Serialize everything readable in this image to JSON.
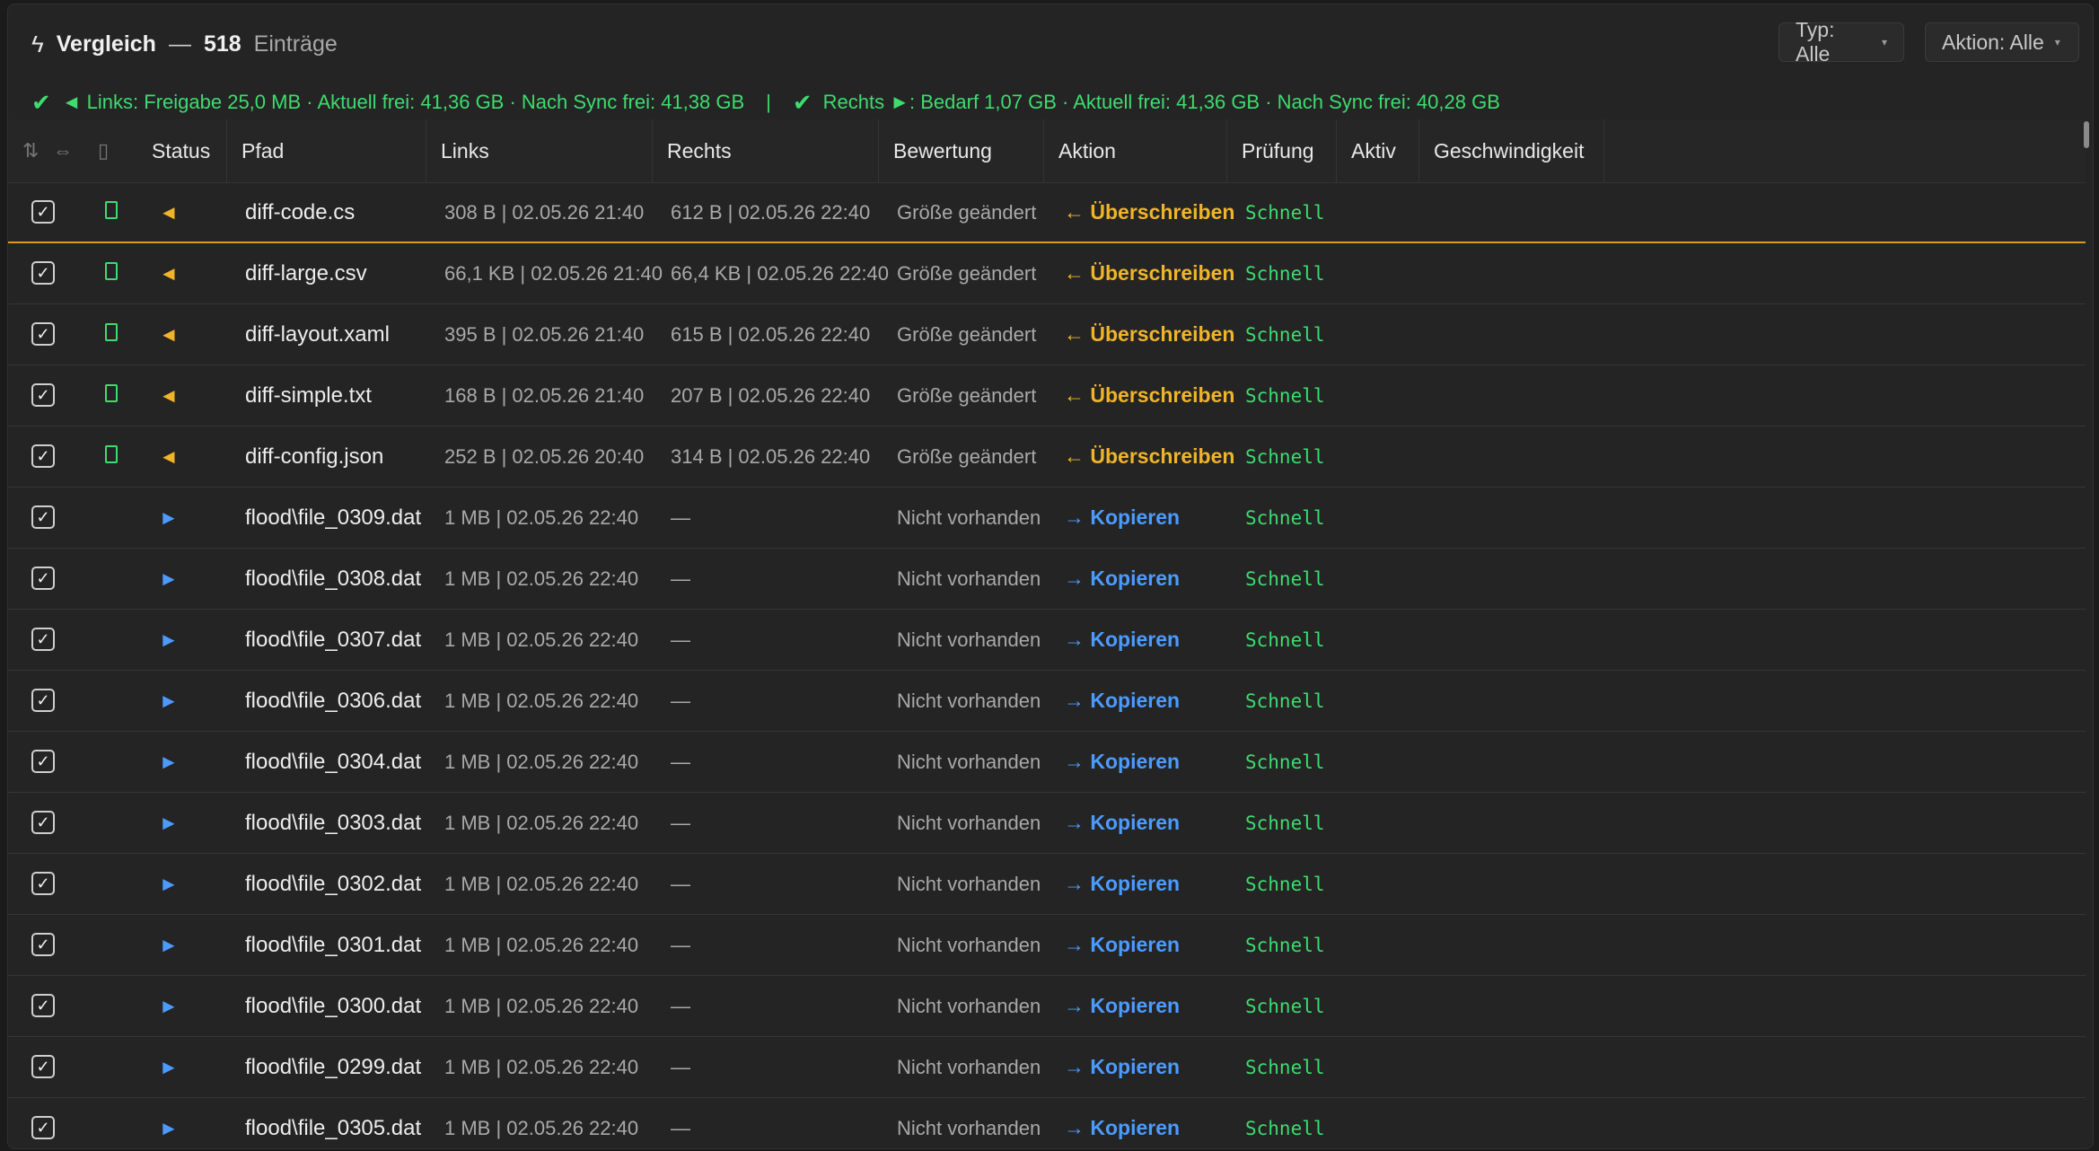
{
  "header": {
    "title": "Vergleich",
    "dash": "—",
    "count": "518",
    "count_unit": "Einträge",
    "filter_typ": "Typ: Alle",
    "filter_aktion": "Aktion: Alle"
  },
  "space": {
    "left": "◄ Links: Freigabe 25,0 MB · Aktuell frei: 41,36 GB · Nach Sync frei: 41,38 GB",
    "separator": "|",
    "right": "Rechts ►: Bedarf 1,07 GB · Aktuell frei: 41,36 GB · Nach Sync frei: 40,28 GB"
  },
  "columns": {
    "status": "Status",
    "pfad": "Pfad",
    "links": "Links",
    "rechts": "Rechts",
    "bewertung": "Bewertung",
    "aktion": "Aktion",
    "pruefung": "Prüfung",
    "aktiv": "Aktiv",
    "geschwindigkeit": "Geschwindigkeit"
  },
  "rows": [
    {
      "path": "diff-code.cs",
      "links": "308 B | 02.05.26 21:40",
      "rechts": "612 B | 02.05.26 22:40",
      "bewertung": "Größe geändert",
      "aktion": "← Überschreiben",
      "pruefung": "Schnell",
      "direction": "left",
      "kind": "overwrite"
    },
    {
      "path": "diff-large.csv",
      "links": "66,1 KB | 02.05.26 21:40",
      "rechts": "66,4 KB | 02.05.26 22:40",
      "bewertung": "Größe geändert",
      "aktion": "← Überschreiben",
      "pruefung": "Schnell",
      "direction": "left",
      "kind": "overwrite"
    },
    {
      "path": "diff-layout.xaml",
      "links": "395 B | 02.05.26 21:40",
      "rechts": "615 B | 02.05.26 22:40",
      "bewertung": "Größe geändert",
      "aktion": "← Überschreiben",
      "pruefung": "Schnell",
      "direction": "left",
      "kind": "overwrite"
    },
    {
      "path": "diff-simple.txt",
      "links": "168 B | 02.05.26 21:40",
      "rechts": "207 B | 02.05.26 22:40",
      "bewertung": "Größe geändert",
      "aktion": "← Überschreiben",
      "pruefung": "Schnell",
      "direction": "left",
      "kind": "overwrite"
    },
    {
      "path": "diff-config.json",
      "links": "252 B | 02.05.26 20:40",
      "rechts": "314 B | 02.05.26 22:40",
      "bewertung": "Größe geändert",
      "aktion": "← Überschreiben",
      "pruefung": "Schnell",
      "direction": "left",
      "kind": "overwrite"
    },
    {
      "path": "flood\\file_0309.dat",
      "links": "1 MB | 02.05.26 22:40",
      "rechts": "—",
      "bewertung": "Nicht vorhanden",
      "aktion": "→ Kopieren",
      "pruefung": "Schnell",
      "direction": "right",
      "kind": "copy"
    },
    {
      "path": "flood\\file_0308.dat",
      "links": "1 MB | 02.05.26 22:40",
      "rechts": "—",
      "bewertung": "Nicht vorhanden",
      "aktion": "→ Kopieren",
      "pruefung": "Schnell",
      "direction": "right",
      "kind": "copy"
    },
    {
      "path": "flood\\file_0307.dat",
      "links": "1 MB | 02.05.26 22:40",
      "rechts": "—",
      "bewertung": "Nicht vorhanden",
      "aktion": "→ Kopieren",
      "pruefung": "Schnell",
      "direction": "right",
      "kind": "copy"
    },
    {
      "path": "flood\\file_0306.dat",
      "links": "1 MB | 02.05.26 22:40",
      "rechts": "—",
      "bewertung": "Nicht vorhanden",
      "aktion": "→ Kopieren",
      "pruefung": "Schnell",
      "direction": "right",
      "kind": "copy"
    },
    {
      "path": "flood\\file_0304.dat",
      "links": "1 MB | 02.05.26 22:40",
      "rechts": "—",
      "bewertung": "Nicht vorhanden",
      "aktion": "→ Kopieren",
      "pruefung": "Schnell",
      "direction": "right",
      "kind": "copy"
    },
    {
      "path": "flood\\file_0303.dat",
      "links": "1 MB | 02.05.26 22:40",
      "rechts": "—",
      "bewertung": "Nicht vorhanden",
      "aktion": "→ Kopieren",
      "pruefung": "Schnell",
      "direction": "right",
      "kind": "copy"
    },
    {
      "path": "flood\\file_0302.dat",
      "links": "1 MB | 02.05.26 22:40",
      "rechts": "—",
      "bewertung": "Nicht vorhanden",
      "aktion": "→ Kopieren",
      "pruefung": "Schnell",
      "direction": "right",
      "kind": "copy"
    },
    {
      "path": "flood\\file_0301.dat",
      "links": "1 MB | 02.05.26 22:40",
      "rechts": "—",
      "bewertung": "Nicht vorhanden",
      "aktion": "→ Kopieren",
      "pruefung": "Schnell",
      "direction": "right",
      "kind": "copy"
    },
    {
      "path": "flood\\file_0300.dat",
      "links": "1 MB | 02.05.26 22:40",
      "rechts": "—",
      "bewertung": "Nicht vorhanden",
      "aktion": "→ Kopieren",
      "pruefung": "Schnell",
      "direction": "right",
      "kind": "copy"
    },
    {
      "path": "flood\\file_0299.dat",
      "links": "1 MB | 02.05.26 22:40",
      "rechts": "—",
      "bewertung": "Nicht vorhanden",
      "aktion": "→ Kopieren",
      "pruefung": "Schnell",
      "direction": "right",
      "kind": "copy"
    },
    {
      "path": "flood\\file_0305.dat",
      "links": "1 MB | 02.05.26 22:40",
      "rechts": "—",
      "bewertung": "Nicht vorhanden",
      "aktion": "→ Kopieren",
      "pruefung": "Schnell",
      "direction": "right",
      "kind": "copy"
    }
  ],
  "colors": {
    "accent_green": "#3ddc6e",
    "overwrite_orange": "#f0b429",
    "copy_blue": "#4b9bff",
    "selection_border": "#d99a2b"
  },
  "icons": {
    "title": "lightning-icon",
    "sort": "sort-arrows-icon",
    "swap": "swap-arrows-icon",
    "file_type": "file-icon",
    "status_ok": "checkmark-icon"
  }
}
